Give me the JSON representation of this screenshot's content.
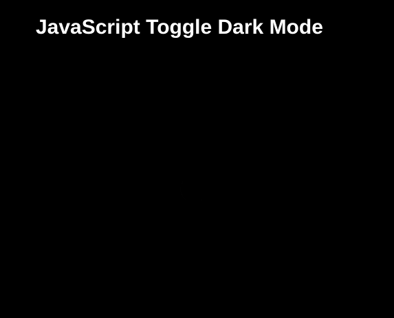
{
  "page": {
    "title": "JavaScript Toggle Dark Mode",
    "background_color": "#000000",
    "text_color": "#ffffff"
  },
  "toggle": {
    "icon": "moon-icon",
    "icon_color": "#ffffff",
    "mode": "dark"
  }
}
